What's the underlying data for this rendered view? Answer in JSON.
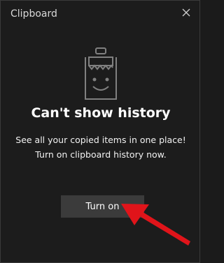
{
  "window": {
    "title": "Clipboard",
    "close_icon": "close-icon"
  },
  "empty_state": {
    "icon": "clipboard-smiley-icon",
    "heading": "Can't show history",
    "description_line1": "See all your copied items in one place!",
    "description_line2": "Turn on clipboard history now."
  },
  "actions": {
    "turn_on_label": "Turn on"
  },
  "annotation": {
    "icon": "red-arrow-icon",
    "color": "#e0141a"
  },
  "colors": {
    "background": "#1c1c1c",
    "button": "#3b3b3b",
    "text": "#ffffff"
  }
}
